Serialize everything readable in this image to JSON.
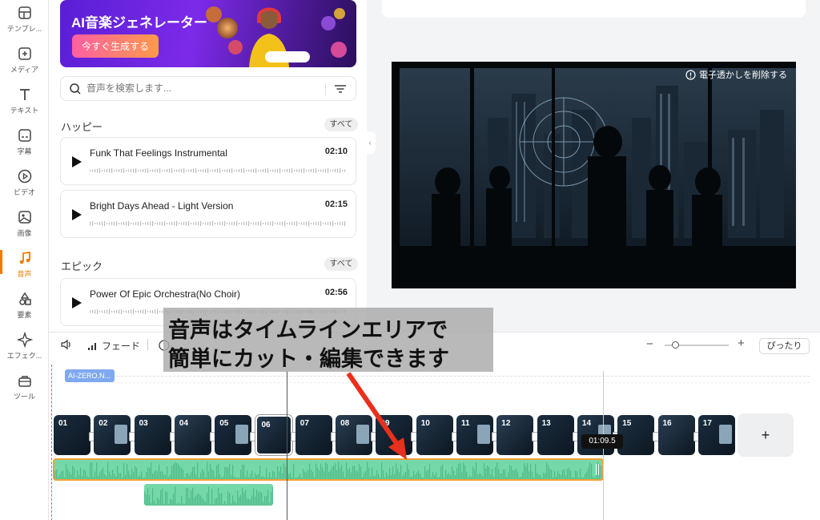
{
  "sidebar": {
    "items": [
      {
        "label": "テンプレ...",
        "icon": "template-icon"
      },
      {
        "label": "メディア",
        "icon": "media-add-icon"
      },
      {
        "label": "テキスト",
        "icon": "text-icon"
      },
      {
        "label": "字幕",
        "icon": "caption-icon"
      },
      {
        "label": "ビデオ",
        "icon": "video-icon"
      },
      {
        "label": "画像",
        "icon": "image-icon"
      },
      {
        "label": "音声",
        "icon": "music-icon"
      },
      {
        "label": "要素",
        "icon": "elements-icon"
      },
      {
        "label": "エフェク...",
        "icon": "effects-icon"
      },
      {
        "label": "ツール",
        "icon": "toolbox-icon"
      }
    ],
    "active": "音声",
    "accent": "#f07b00"
  },
  "banner": {
    "title": "AI音楽ジェネレーター",
    "button": "今すぐ生成する"
  },
  "search": {
    "placeholder": "音声を検索します..."
  },
  "sections": [
    {
      "title": "ハッピー",
      "see_all": "すべて",
      "tracks": [
        {
          "name": "Funk That Feelings Instrumental",
          "duration": "02:10"
        },
        {
          "name": "Bright Days Ahead - Light Version",
          "duration": "02:15"
        }
      ]
    },
    {
      "title": "エピック",
      "see_all": "すべて",
      "tracks": [
        {
          "name": "Power Of Epic Orchestra(No Choir)",
          "duration": "02:56"
        }
      ]
    }
  ],
  "preview": {
    "watermark": "電子透かしを削除する"
  },
  "timeline": {
    "toolbar": {
      "fade": "フェード",
      "fit": "ぴったり"
    },
    "tag": "AI-ZERO.N...",
    "clips": [
      "01",
      "02",
      "03",
      "04",
      "05",
      "06",
      "07",
      "08",
      "09",
      "10",
      "11",
      "12",
      "13",
      "14",
      "15",
      "16",
      "17"
    ],
    "selected_clip": "06",
    "time_badge": "01:09.5",
    "add_label": "+"
  },
  "annotation": {
    "line1": "音声はタイムラインエリアで",
    "line2": "簡単にカット・編集できます",
    "arrow_color": "#e8301c"
  }
}
